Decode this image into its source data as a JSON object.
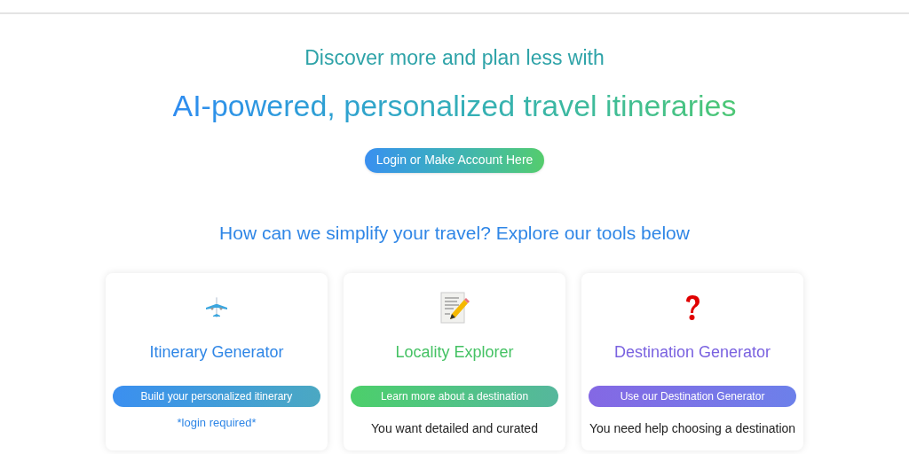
{
  "hero": {
    "subtitle": "Discover more and plan less with",
    "title": "AI-powered, personalized travel itineraries",
    "login_button": "Login or Make Account Here"
  },
  "tools_heading": "How can we simplify your travel? Explore our tools below",
  "tools": [
    {
      "kind": "plane",
      "title": "Itinerary Generator",
      "color": "#2f86e6",
      "button": "Build your personalized itinerary",
      "note": "*login required*"
    },
    {
      "kind": "notepad",
      "title": "Locality Explorer",
      "color": "#45c264",
      "button": "Learn more about a destination",
      "description": "You want detailed and curated"
    },
    {
      "kind": "question",
      "title": "Destination Generator",
      "color": "#7a62e0",
      "button": "Use our Destination Generator",
      "description": "You need help choosing a destination"
    }
  ]
}
